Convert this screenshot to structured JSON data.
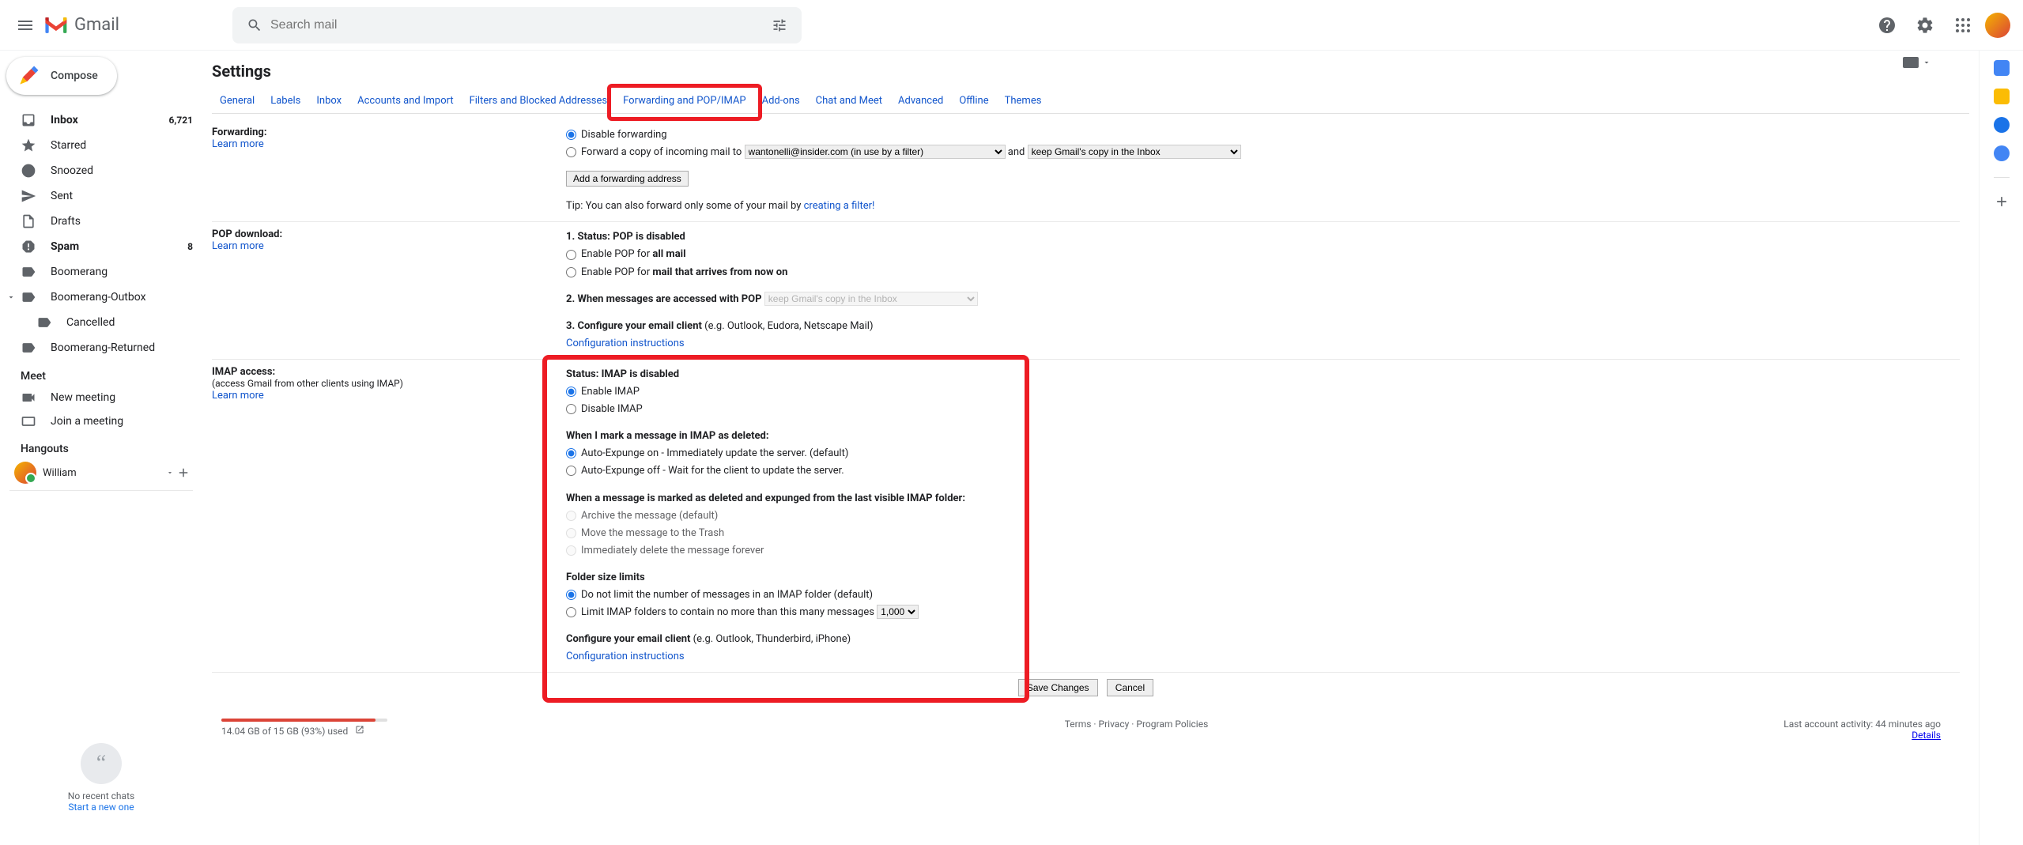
{
  "app": {
    "name": "Gmail"
  },
  "search": {
    "placeholder": "Search mail"
  },
  "compose": {
    "label": "Compose"
  },
  "nav": {
    "inbox": {
      "label": "Inbox",
      "count": "6,721"
    },
    "starred": {
      "label": "Starred"
    },
    "snoozed": {
      "label": "Snoozed"
    },
    "sent": {
      "label": "Sent"
    },
    "drafts": {
      "label": "Drafts"
    },
    "spam": {
      "label": "Spam",
      "count": "8"
    },
    "boomerang": {
      "label": "Boomerang"
    },
    "boomerang_outbox": {
      "label": "Boomerang-Outbox"
    },
    "cancelled": {
      "label": "Cancelled"
    },
    "boomerang_returned": {
      "label": "Boomerang-Returned"
    }
  },
  "meet": {
    "title": "Meet",
    "new": "New meeting",
    "join": "Join a meeting"
  },
  "hangouts": {
    "title": "Hangouts",
    "name": "William",
    "empty": "No recent chats",
    "start": "Start a new one"
  },
  "settings": {
    "title": "Settings",
    "tabs": {
      "general": "General",
      "labels": "Labels",
      "inbox": "Inbox",
      "accounts": "Accounts and Import",
      "filters": "Filters and Blocked Addresses",
      "forwarding": "Forwarding and POP/IMAP",
      "addons": "Add-ons",
      "chat": "Chat and Meet",
      "advanced": "Advanced",
      "offline": "Offline",
      "themes": "Themes"
    }
  },
  "forwarding": {
    "label": "Forwarding:",
    "learn": "Learn more",
    "disable": "Disable forwarding",
    "forward_copy": "Forward a copy of incoming mail to ",
    "forward_address": "wantonelli@insider.com (in use by a filter)",
    "and": " and ",
    "keep": "keep Gmail's copy in the Inbox",
    "add": "Add a forwarding address",
    "tip": "Tip: You can also forward only some of your mail by ",
    "filter_link": "creating a filter!"
  },
  "pop": {
    "label": "POP download:",
    "learn": "Learn more",
    "status_prefix": "1. Status: ",
    "status": "POP is disabled",
    "enable_all_pre": "Enable POP for ",
    "enable_all": "all mail",
    "enable_now_pre": "Enable POP for ",
    "enable_now": "mail that arrives from now on",
    "accessed": "2. When messages are accessed with POP ",
    "accessed_opt": "keep Gmail's copy in the Inbox",
    "configure": "3. Configure your email client ",
    "configure_hint": "(e.g. Outlook, Eudora, Netscape Mail)",
    "instructions": "Configuration instructions"
  },
  "imap": {
    "label": "IMAP access:",
    "sub": "(access Gmail from other clients using IMAP)",
    "learn": "Learn more",
    "status": "Status: IMAP is disabled",
    "enable": "Enable IMAP",
    "disable": "Disable IMAP",
    "mark_deleted": "When I mark a message in IMAP as deleted:",
    "expunge_on": "Auto-Expunge on - Immediately update the server. (default)",
    "expunge_off": "Auto-Expunge off - Wait for the client to update the server.",
    "expunged": "When a message is marked as deleted and expunged from the last visible IMAP folder:",
    "archive": "Archive the message (default)",
    "trash": "Move the message to the Trash",
    "delete": "Immediately delete the message forever",
    "folder": "Folder size limits",
    "nolimit": "Do not limit the number of messages in an IMAP folder (default)",
    "limit": "Limit IMAP folders to contain no more than this many messages ",
    "limit_val": "1,000",
    "configure": "Configure your email client ",
    "configure_hint": "(e.g. Outlook, Thunderbird, iPhone)",
    "instructions": "Configuration instructions"
  },
  "actions": {
    "save": "Save Changes",
    "cancel": "Cancel"
  },
  "footer": {
    "storage": "14.04 GB of 15 GB (93%) used",
    "terms": "Terms",
    "privacy": "Privacy",
    "policies": "Program Policies",
    "activity": "Last account activity: 44 minutes ago",
    "details": "Details"
  }
}
